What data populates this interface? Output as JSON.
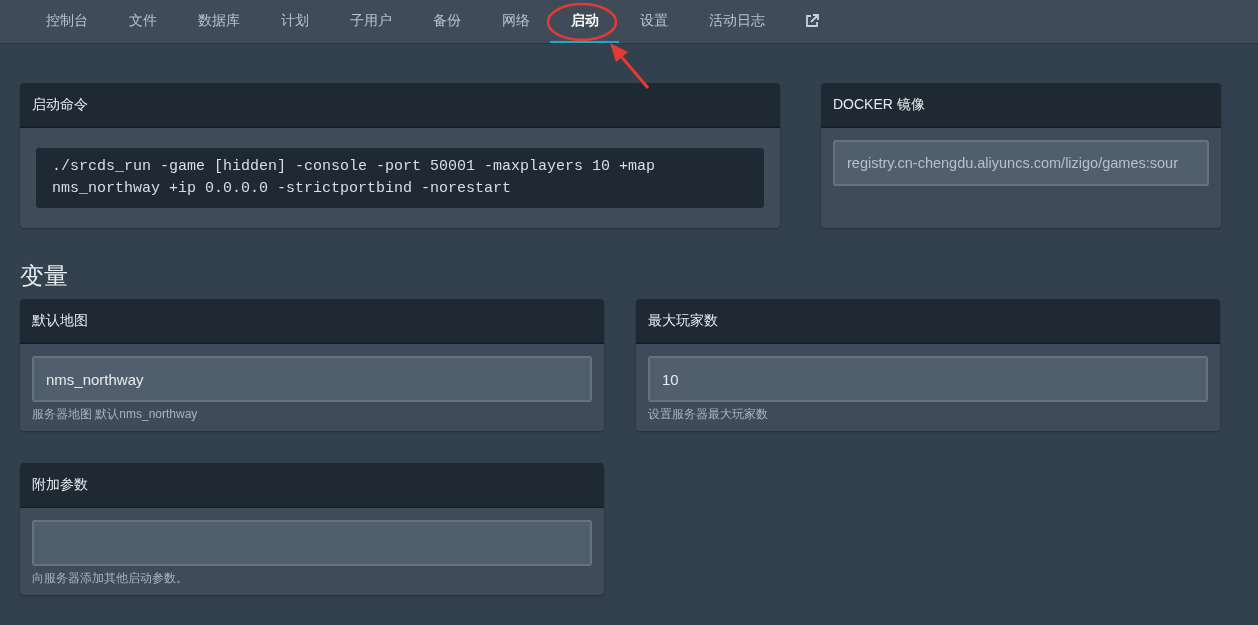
{
  "nav": {
    "tabs": [
      {
        "label": "控制台",
        "selected": false
      },
      {
        "label": "文件",
        "selected": false
      },
      {
        "label": "数据库",
        "selected": false
      },
      {
        "label": "计划",
        "selected": false
      },
      {
        "label": "子用户",
        "selected": false
      },
      {
        "label": "备份",
        "selected": false
      },
      {
        "label": "网络",
        "selected": false
      },
      {
        "label": "启动",
        "selected": true
      },
      {
        "label": "设置",
        "selected": false
      },
      {
        "label": "活动日志",
        "selected": false
      }
    ]
  },
  "startup": {
    "title": "启动命令",
    "command": "./srcds_run -game [hidden] -console -port 50001 -maxplayers 10 +map nms_northway +ip 0.0.0.0 -strictportbind -norestart"
  },
  "docker": {
    "title": "DOCKER 镜像",
    "value": "registry.cn-chengdu.aliyuncs.com/lizigo/games:sour"
  },
  "variables": {
    "heading": "变量",
    "items": [
      {
        "title": "默认地图",
        "value": "nms_northway",
        "description": "服务器地图 默认nms_northway"
      },
      {
        "title": "最大玩家数",
        "value": "10",
        "description": "设置服务器最大玩家数"
      },
      {
        "title": "附加参数",
        "value": "",
        "description": "向服务器添加其他启动参数。"
      }
    ]
  }
}
